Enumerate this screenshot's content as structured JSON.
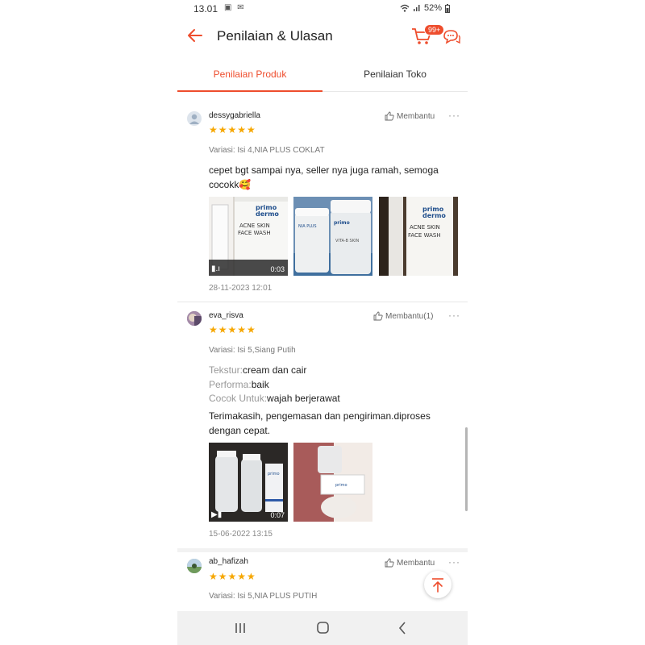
{
  "status_bar": {
    "time": "13.01",
    "battery": "52%"
  },
  "header": {
    "title": "Penilaian & Ulasan",
    "cart_badge": "99+"
  },
  "tabs": [
    {
      "label": "Penilaian Produk",
      "active": true
    },
    {
      "label": "Penilaian Toko",
      "active": false
    }
  ],
  "reviews": [
    {
      "username": "dessygabriella",
      "helpful_label": "Membantu",
      "more": "···",
      "rating": 5,
      "stars": "★★★★★",
      "variant": "Variasi: Isi 4,NIA PLUS COKLAT",
      "text": "cepet bgt sampai nya, seller nya juga ramah, semoga cocokk🥰",
      "video_duration": "0:03",
      "date": "28-11-2023 12:01"
    },
    {
      "username": "eva_risva",
      "helpful_label": "Membantu(1)",
      "more": "···",
      "rating": 5,
      "stars": "★★★★★",
      "variant": "Variasi: Isi 5,Siang Putih",
      "attributes": [
        {
          "label": "Tekstur:",
          "value": "cream dan cair"
        },
        {
          "label": "Performa:",
          "value": "baik"
        },
        {
          "label": "Cocok Untuk:",
          "value": "wajah berjerawat"
        }
      ],
      "text": "Terimakasih, pengemasan dan pengiriman.diproses dengan cepat.",
      "video_duration": "0:07",
      "date": "15-06-2022 13:15"
    },
    {
      "username": "ab_hafizah",
      "helpful_label": "Membantu",
      "more": "···",
      "rating": 5,
      "stars": "★★★★★",
      "variant": "Variasi: Isi 5,NIA PLUS PUTIH"
    }
  ],
  "product_images": {
    "brand": "primo dermo",
    "line1": "ACNE SKIN",
    "line2": "FACE WASH",
    "jar_label": "primo dermo"
  },
  "colors": {
    "accent": "#ee4d2d",
    "star": "#f6a700"
  },
  "icons": [
    "back-arrow-icon",
    "cart-icon",
    "chat-icon",
    "thumbs-up-icon",
    "scroll-top-icon",
    "recents-icon",
    "home-icon",
    "back-nav-icon"
  ]
}
